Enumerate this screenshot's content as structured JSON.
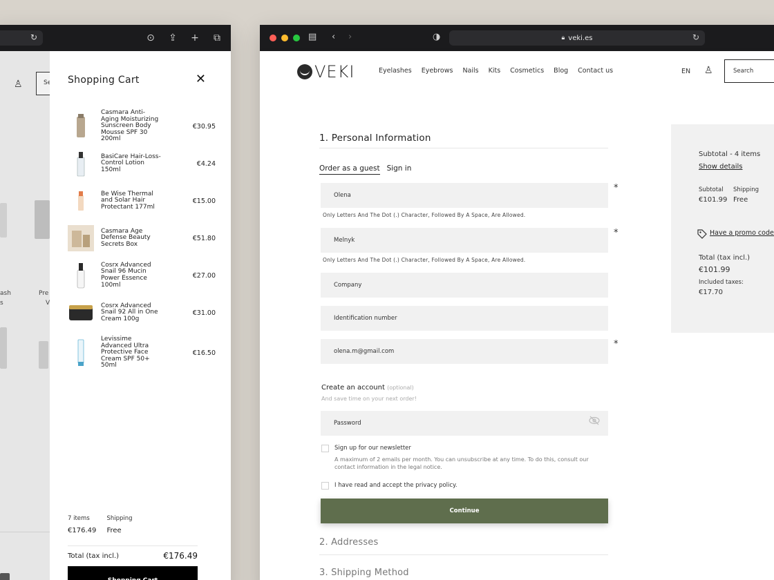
{
  "left_window": {
    "bar_icons": [
      "reload-icon",
      "download-icon",
      "share-icon",
      "plus-icon",
      "tabs-icon"
    ],
    "background_store": {
      "search_fragment": "Se",
      "label_fragments": [
        "ash",
        "s",
        "Pre",
        "V"
      ]
    },
    "cart": {
      "title": "Shopping Cart",
      "items": [
        {
          "name": "Casmara Anti-Aging Moisturizing Sunscreen Body Mousse SPF 30 200ml",
          "price": "€30.95"
        },
        {
          "name": "BasiCare Hair-Loss-Control Lotion 150ml",
          "price": "€4.24"
        },
        {
          "name": "Be Wise Thermal and Solar Hair Protectant 177ml",
          "price": "€15.00"
        },
        {
          "name": "Casmara Age Defense Beauty Secrets Box",
          "price": "€51.80"
        },
        {
          "name": "Cosrx Advanced Snail 96 Mucin Power Essence 100ml",
          "price": "€27.00"
        },
        {
          "name": "Cosrx Advanced Snail 92 All in One Cream 100g",
          "price": "€31.00"
        },
        {
          "name": "Levissime Advanced Ultra Protective Face Cream SPF 50+ 50ml",
          "price": "€16.50"
        }
      ],
      "summary": {
        "items_label": "7 items",
        "items_value": "€176.49",
        "shipping_label": "Shipping",
        "shipping_value": "Free"
      },
      "total_label": "Total (tax incl.)",
      "total_value": "€176.49",
      "button_label": "Shopping Cart"
    }
  },
  "right_window": {
    "url": "veki.es",
    "header": {
      "logo_text": "VEKI",
      "nav": [
        "Eyelashes",
        "Eyebrows",
        "Nails",
        "Kits",
        "Cosmetics",
        "Blog",
        "Contact us"
      ],
      "lang": "EN",
      "search_placeholder": "Search"
    },
    "checkout": {
      "section1_title": "1. Personal Information",
      "tabs": {
        "guest": "Order as a guest",
        "signin": "Sign in"
      },
      "fields": {
        "first_name": "Olena",
        "last_name": "Melnyk",
        "company": "Company",
        "id_number": "Identification number",
        "email": "olena.m@gmail.com",
        "password": "Password"
      },
      "name_hint": "Only Letters And The Dot (.) Character, Followed By A Space, Are Allowed.",
      "required_mark": "*",
      "create_account_title": "Create an account",
      "create_account_optional": "(optional)",
      "create_account_sub": "And save time on your next order!",
      "newsletter_label": "Sign up for our newsletter",
      "newsletter_desc": "A maximum of 2 emails per month. You can unsubscribe at any time. To do this, consult our contact information in the legal notice.",
      "privacy_label": "I have read and accept the privacy policy.",
      "continue_label": "Continue",
      "section2_title": "2. Addresses",
      "section3_title": "3. Shipping Method"
    },
    "order_summary": {
      "subtotal_heading": "Subtotal - 4 items",
      "show_details": "Show details",
      "subtotal_label": "Subtotal",
      "subtotal_value": "€101.99",
      "shipping_label": "Shipping",
      "shipping_value": "Free",
      "promo_label": "Have a promo code?",
      "total_label": "Total (tax incl.)",
      "total_value": "€101.99",
      "taxes_label": "Included taxes:",
      "taxes_value": "€17.70"
    }
  },
  "colors": {
    "continue_button": "#5f6e4d",
    "cart_button": "#000000",
    "browser_bar": "#1b1b1d"
  }
}
